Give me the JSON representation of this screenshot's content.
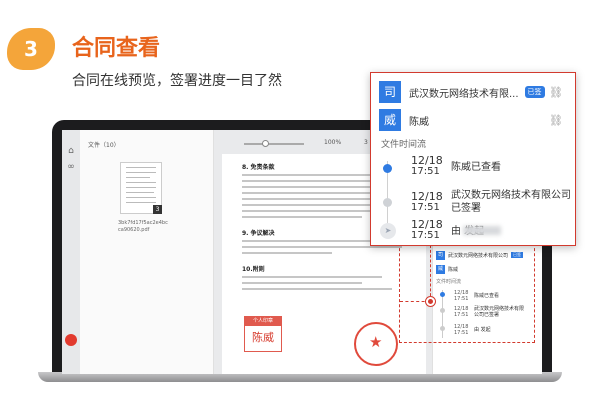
{
  "header": {
    "step_number": "3",
    "title": "合同查看",
    "subtitle": "合同在线预览，签署进度一目了然"
  },
  "colors": {
    "accent_orange": "#e8641c",
    "badge_orange": "#f4a53a",
    "highlight_red": "#d23a2e",
    "brand_blue": "#2f7be2"
  },
  "screen": {
    "file_panel": {
      "heading": "文件（10）",
      "file_name": "3bk7fd17f5ac2e4bcca90620.pdf",
      "page_badge": "3"
    },
    "toolbar": {
      "zoom": "100%",
      "page_current": "3",
      "page_total": "3"
    },
    "document": {
      "sections": [
        "8. 免责条款",
        "9. 争议解决",
        "10.附则"
      ],
      "stamp_caption": "个人印章",
      "stamp_name": "陈威"
    },
    "mini_popup": {
      "company": "武汉数元网络技术有限公司",
      "signed_badge": "已签",
      "person": "陈威",
      "timeline_title": "文件时间流"
    }
  },
  "popup": {
    "rows": [
      {
        "icon": "司",
        "name": "武汉数元网络技术有限...",
        "badge": "已签",
        "link_icon": "link-icon"
      },
      {
        "icon": "威",
        "name": "陈威",
        "badge": "",
        "link_icon": "link-icon"
      }
    ],
    "timeline_title": "文件时间流",
    "events": [
      {
        "date": "12/18",
        "time": "17:51",
        "text": "陈威已查看"
      },
      {
        "date": "12/18",
        "time": "17:51",
        "text": "武汉数元网络技术有限公司已签署"
      },
      {
        "date": "12/18",
        "time": "17:51",
        "text": "由 发起"
      }
    ]
  }
}
